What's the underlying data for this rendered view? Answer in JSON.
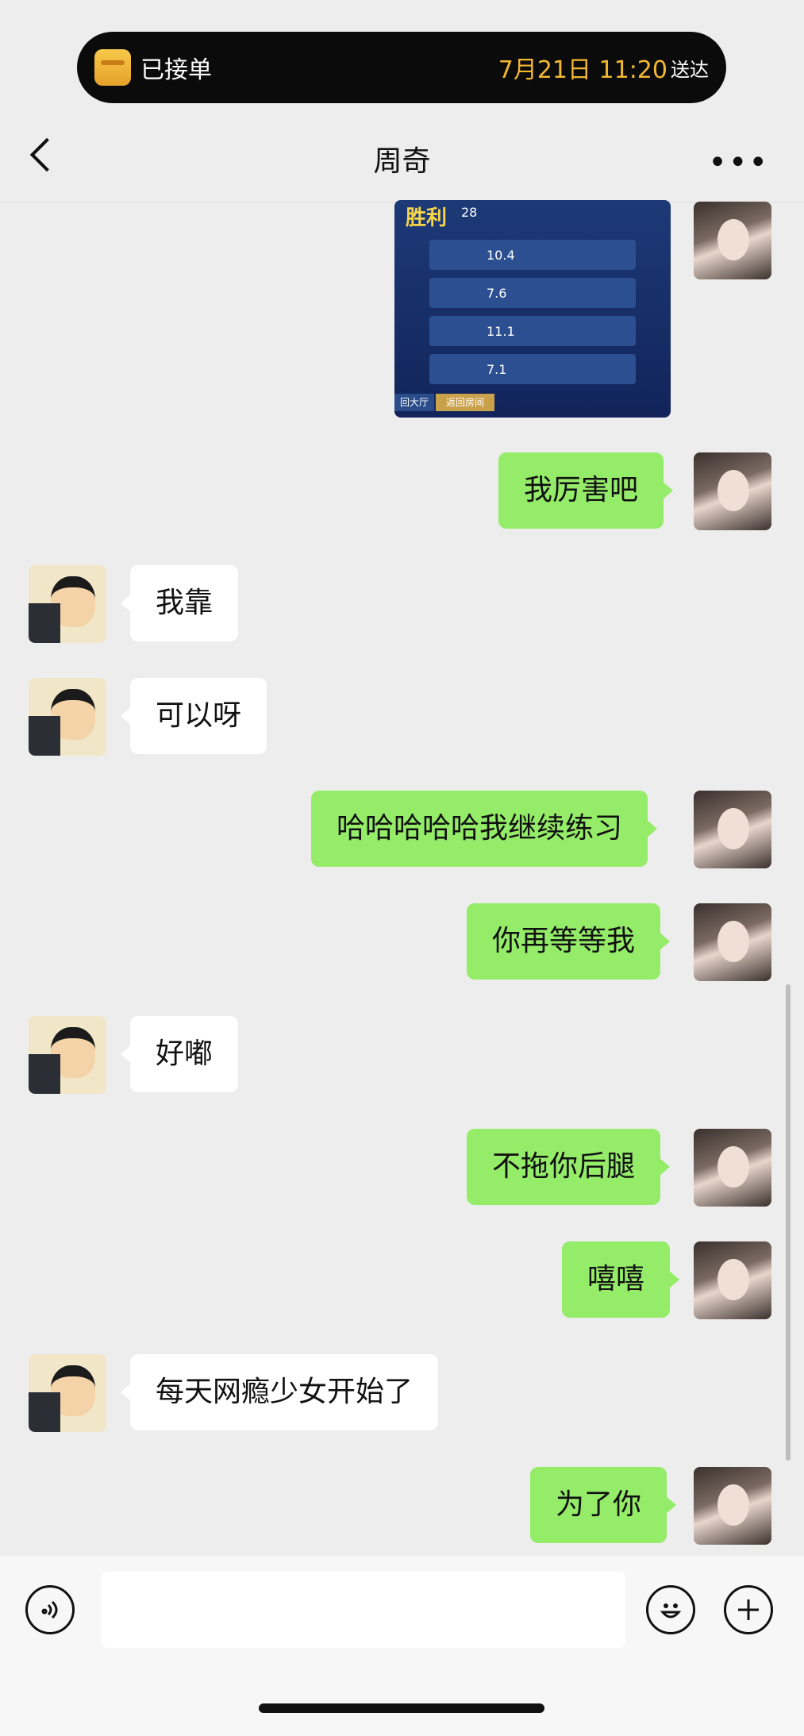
{
  "notification": {
    "status": "已接单",
    "time": "7月21日 11:20",
    "suffix": "送达"
  },
  "header": {
    "title": "周奇",
    "more": "•••"
  },
  "image_message": {
    "banner": "胜利",
    "banner_num": "28",
    "row_scores": [
      "10.4",
      "7.6",
      "11.1",
      "7.1"
    ],
    "button_left": "回大厅",
    "button_right": "返回房间"
  },
  "messages": [
    {
      "from": "me",
      "text": "我厉害吧"
    },
    {
      "from": "friend",
      "text": "我靠"
    },
    {
      "from": "friend",
      "text": "可以呀"
    },
    {
      "from": "me",
      "text": "哈哈哈哈哈我继续练习"
    },
    {
      "from": "me",
      "text": "你再等等我"
    },
    {
      "from": "friend",
      "text": "好嘟"
    },
    {
      "from": "me",
      "text": "不拖你后腿"
    },
    {
      "from": "me",
      "text": "嘻嘻"
    },
    {
      "from": "friend",
      "text": "每天网瘾少女开始了"
    },
    {
      "from": "me",
      "text": "为了你"
    }
  ],
  "icons": {
    "back": "chevron-left-icon",
    "voice": "voice-icon",
    "emoji": "emoji-icon",
    "add": "plus-icon"
  },
  "colors": {
    "my_bubble": "#95ec69",
    "friend_bubble": "#ffffff",
    "background": "#ededed",
    "accent_time": "#f3b832"
  }
}
